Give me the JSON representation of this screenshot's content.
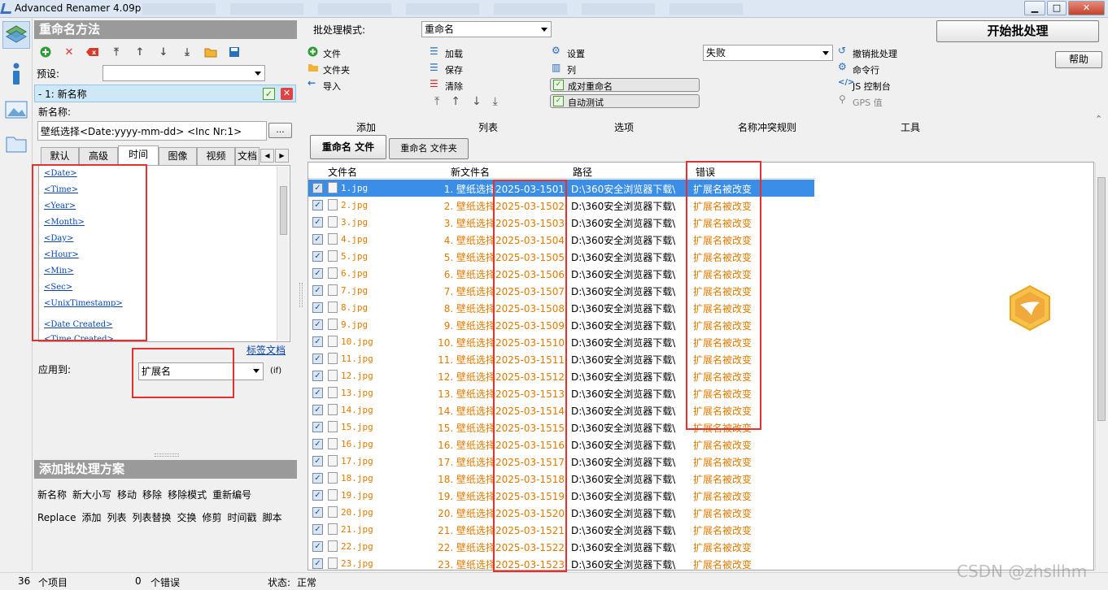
{
  "window": {
    "title": "Advanced Renamer 4.09p",
    "minimize": "▁",
    "maximize": "□",
    "close": "✕"
  },
  "left": {
    "method_header": "重命名方法",
    "preset_label": "预设:",
    "preset_value": "",
    "method_item": "- 1:  新名称",
    "new_name_label": "新名称:",
    "new_name_value": "壁纸选择<Date:yyyy-mm-dd> <Inc Nr:1>",
    "browse_btn": "...",
    "tabs": [
      "默认",
      "高级",
      "时间",
      "图像",
      "视频",
      "文档"
    ],
    "tags": [
      "<Date>",
      "<Time>",
      "<Year>",
      "<Month>",
      "<Day>",
      "<Hour>",
      "<Min>",
      "<Sec>",
      "<UnixTimestamp>",
      "<Date Created>",
      "<Time Created>"
    ],
    "tag_doc_link": "标签文档",
    "apply_label": "应用到:",
    "apply_value": "扩展名",
    "apply_hint": "(if)",
    "batch_header": "添加批处理方案",
    "methods_row1": [
      "新名称",
      "新大小写",
      "移动",
      "移除",
      "移除模式",
      "重新编号"
    ],
    "methods_row2": [
      "Replace",
      "添加",
      "列表",
      "列表替换",
      "交换",
      "修剪",
      "时间戳",
      "脚本"
    ]
  },
  "toolbar": {
    "mode_label": "批处理模式:",
    "mode_value": "重命名",
    "add_file": "文件",
    "add_folder": "文件夹",
    "import": "导入",
    "load": "加载",
    "save": "保存",
    "clear": "清除",
    "settings": "设置",
    "columns": "列",
    "pair_rename": "成对重命名",
    "auto_test": "自动测试",
    "fail_value": "失败",
    "undo_batch": "撤销批处理",
    "cmdline": "命令行",
    "js_console": "JS 控制台",
    "gps": "GPS 值",
    "start_btn": "开始批处理",
    "help_btn": "帮助",
    "sections": [
      "添加",
      "列表",
      "选项",
      "名称冲突规则",
      "工具"
    ],
    "tab_files": "重命名 文件",
    "tab_folders": "重命名 文件夹"
  },
  "grid": {
    "columns": [
      "文件名",
      "新文件名",
      "路径",
      "错误"
    ],
    "rows": [
      {
        "file": "1.jpg",
        "new": "1. 壁纸选择2025-03-1501",
        "path": "D:\\360安全浏览器下载\\",
        "error": "扩展名被改变"
      },
      {
        "file": "2.jpg",
        "new": "2. 壁纸选择2025-03-1502",
        "path": "D:\\360安全浏览器下载\\",
        "error": "扩展名被改变"
      },
      {
        "file": "3.jpg",
        "new": "3. 壁纸选择2025-03-1503",
        "path": "D:\\360安全浏览器下载\\",
        "error": "扩展名被改变"
      },
      {
        "file": "4.jpg",
        "new": "4. 壁纸选择2025-03-1504",
        "path": "D:\\360安全浏览器下载\\",
        "error": "扩展名被改变"
      },
      {
        "file": "5.jpg",
        "new": "5. 壁纸选择2025-03-1505",
        "path": "D:\\360安全浏览器下载\\",
        "error": "扩展名被改变"
      },
      {
        "file": "6.jpg",
        "new": "6. 壁纸选择2025-03-1506",
        "path": "D:\\360安全浏览器下载\\",
        "error": "扩展名被改变"
      },
      {
        "file": "7.jpg",
        "new": "7. 壁纸选择2025-03-1507",
        "path": "D:\\360安全浏览器下载\\",
        "error": "扩展名被改变"
      },
      {
        "file": "8.jpg",
        "new": "8. 壁纸选择2025-03-1508",
        "path": "D:\\360安全浏览器下载\\",
        "error": "扩展名被改变"
      },
      {
        "file": "9.jpg",
        "new": "9. 壁纸选择2025-03-1509",
        "path": "D:\\360安全浏览器下载\\",
        "error": "扩展名被改变"
      },
      {
        "file": "10.jpg",
        "new": "10. 壁纸选择2025-03-1510",
        "path": "D:\\360安全浏览器下载\\",
        "error": "扩展名被改变"
      },
      {
        "file": "11.jpg",
        "new": "11. 壁纸选择2025-03-1511",
        "path": "D:\\360安全浏览器下载\\",
        "error": "扩展名被改变"
      },
      {
        "file": "12.jpg",
        "new": "12. 壁纸选择2025-03-1512",
        "path": "D:\\360安全浏览器下载\\",
        "error": "扩展名被改变"
      },
      {
        "file": "13.jpg",
        "new": "13. 壁纸选择2025-03-1513",
        "path": "D:\\360安全浏览器下载\\",
        "error": "扩展名被改变"
      },
      {
        "file": "14.jpg",
        "new": "14. 壁纸选择2025-03-1514",
        "path": "D:\\360安全浏览器下载\\",
        "error": "扩展名被改变"
      },
      {
        "file": "15.jpg",
        "new": "15. 壁纸选择2025-03-1515",
        "path": "D:\\360安全浏览器下载\\",
        "error": "扩展名被改变"
      },
      {
        "file": "16.jpg",
        "new": "16. 壁纸选择2025-03-1516",
        "path": "D:\\360安全浏览器下载\\",
        "error": "扩展名被改变"
      },
      {
        "file": "17.jpg",
        "new": "17. 壁纸选择2025-03-1517",
        "path": "D:\\360安全浏览器下载\\",
        "error": "扩展名被改变"
      },
      {
        "file": "18.jpg",
        "new": "18. 壁纸选择2025-03-1518",
        "path": "D:\\360安全浏览器下载\\",
        "error": "扩展名被改变"
      },
      {
        "file": "19.jpg",
        "new": "19. 壁纸选择2025-03-1519",
        "path": "D:\\360安全浏览器下载\\",
        "error": "扩展名被改变"
      },
      {
        "file": "20.jpg",
        "new": "20. 壁纸选择2025-03-1520",
        "path": "D:\\360安全浏览器下载\\",
        "error": "扩展名被改变"
      },
      {
        "file": "21.jpg",
        "new": "21. 壁纸选择2025-03-1521",
        "path": "D:\\360安全浏览器下载\\",
        "error": "扩展名被改变"
      },
      {
        "file": "22.jpg",
        "new": "22. 壁纸选择2025-03-1522",
        "path": "D:\\360安全浏览器下载\\",
        "error": "扩展名被改变"
      },
      {
        "file": "23.jpg",
        "new": "23. 壁纸选择2025-03-1523",
        "path": "D:\\360安全浏览器下载\\",
        "error": "扩展名被改变"
      }
    ]
  },
  "status": {
    "items_count": "36",
    "items_label": "个项目",
    "errors_count": "0",
    "errors_label": "个错误",
    "state_label": "状态:",
    "state_value": "正常"
  },
  "watermark": "CSDN @zhsllhm"
}
